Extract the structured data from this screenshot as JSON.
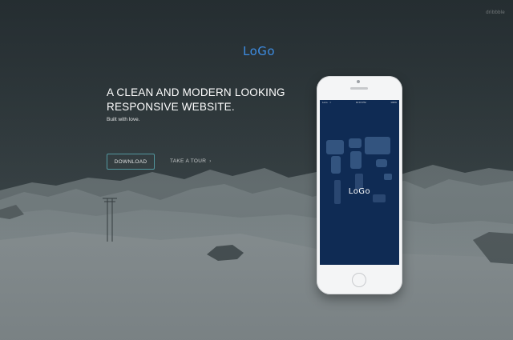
{
  "brand": {
    "logo_text": "LoGo",
    "accent_color": "#3d8be0"
  },
  "watermark": "dribbble",
  "hero": {
    "headline": "A CLEAN AND MODERN LOOKING RESPONSIVE WEBSITE.",
    "tagline": "Built with love.",
    "download_label": "DOWNLOAD",
    "tour_label": "TAKE A TOUR",
    "tour_icon": "chevron-right-icon",
    "background": "snowy-mountain-landscape"
  },
  "phone": {
    "status": {
      "carrier": "Loco",
      "time": "10:15 PM",
      "battery": "100%"
    },
    "app_logo_text": "LoGo",
    "screen_color": "#0f2b54"
  }
}
